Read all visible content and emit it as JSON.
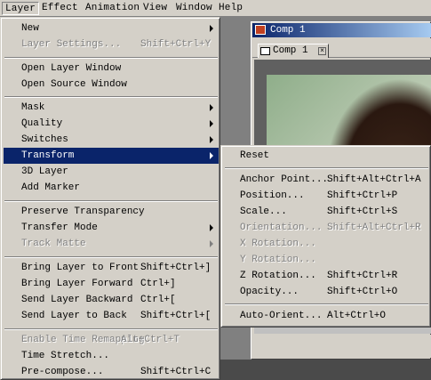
{
  "menubar": {
    "items": [
      {
        "label": "Layer",
        "active": true
      },
      {
        "label": "Effect"
      },
      {
        "label": "Animation"
      },
      {
        "label": "View"
      },
      {
        "label": "Window"
      },
      {
        "label": "Help"
      }
    ]
  },
  "comp": {
    "window_title": "Comp 1",
    "tab_label": "Comp 1"
  },
  "layer_menu": {
    "items": [
      {
        "label": "New",
        "arrow": true
      },
      {
        "label": "Layer Settings...",
        "shortcut": "Shift+Ctrl+Y",
        "disabled": true
      },
      {
        "label": "Open Layer Window"
      },
      {
        "label": "Open Source Window"
      },
      {
        "label": "Mask",
        "arrow": true
      },
      {
        "label": "Quality",
        "arrow": true
      },
      {
        "label": "Switches",
        "arrow": true
      },
      {
        "label": "Transform",
        "arrow": true,
        "highlight": true
      },
      {
        "label": "3D Layer"
      },
      {
        "label": "Add Marker"
      },
      {
        "label": "Preserve Transparency"
      },
      {
        "label": "Transfer Mode",
        "arrow": true
      },
      {
        "label": "Track Matte",
        "arrow": true,
        "disabled": true
      },
      {
        "label": "Bring Layer to Front",
        "shortcut": "Shift+Ctrl+]"
      },
      {
        "label": "Bring Layer Forward",
        "shortcut": "Ctrl+]"
      },
      {
        "label": "Send Layer Backward",
        "shortcut": "Ctrl+["
      },
      {
        "label": "Send Layer to Back",
        "shortcut": "Shift+Ctrl+["
      },
      {
        "label": "Enable Time Remapping",
        "shortcut": "Alt+Ctrl+T",
        "disabled": true
      },
      {
        "label": "Time Stretch..."
      },
      {
        "label": "Pre-compose...",
        "shortcut": "Shift+Ctrl+C"
      }
    ]
  },
  "transform_menu": {
    "items": [
      {
        "label": "Reset"
      },
      {
        "label": "Anchor Point...",
        "shortcut": "Shift+Alt+Ctrl+A"
      },
      {
        "label": "Position...",
        "shortcut": "Shift+Ctrl+P"
      },
      {
        "label": "Scale...",
        "shortcut": "Shift+Ctrl+S"
      },
      {
        "label": "Orientation...",
        "shortcut": "Shift+Alt+Ctrl+R",
        "disabled": true
      },
      {
        "label": "X Rotation...",
        "disabled": true
      },
      {
        "label": "Y Rotation...",
        "disabled": true
      },
      {
        "label": "Z Rotation...",
        "shortcut": "Shift+Ctrl+R"
      },
      {
        "label": "Opacity...",
        "shortcut": "Shift+Ctrl+O"
      },
      {
        "label": "Auto-Orient...",
        "shortcut": "Alt+Ctrl+O"
      }
    ]
  }
}
